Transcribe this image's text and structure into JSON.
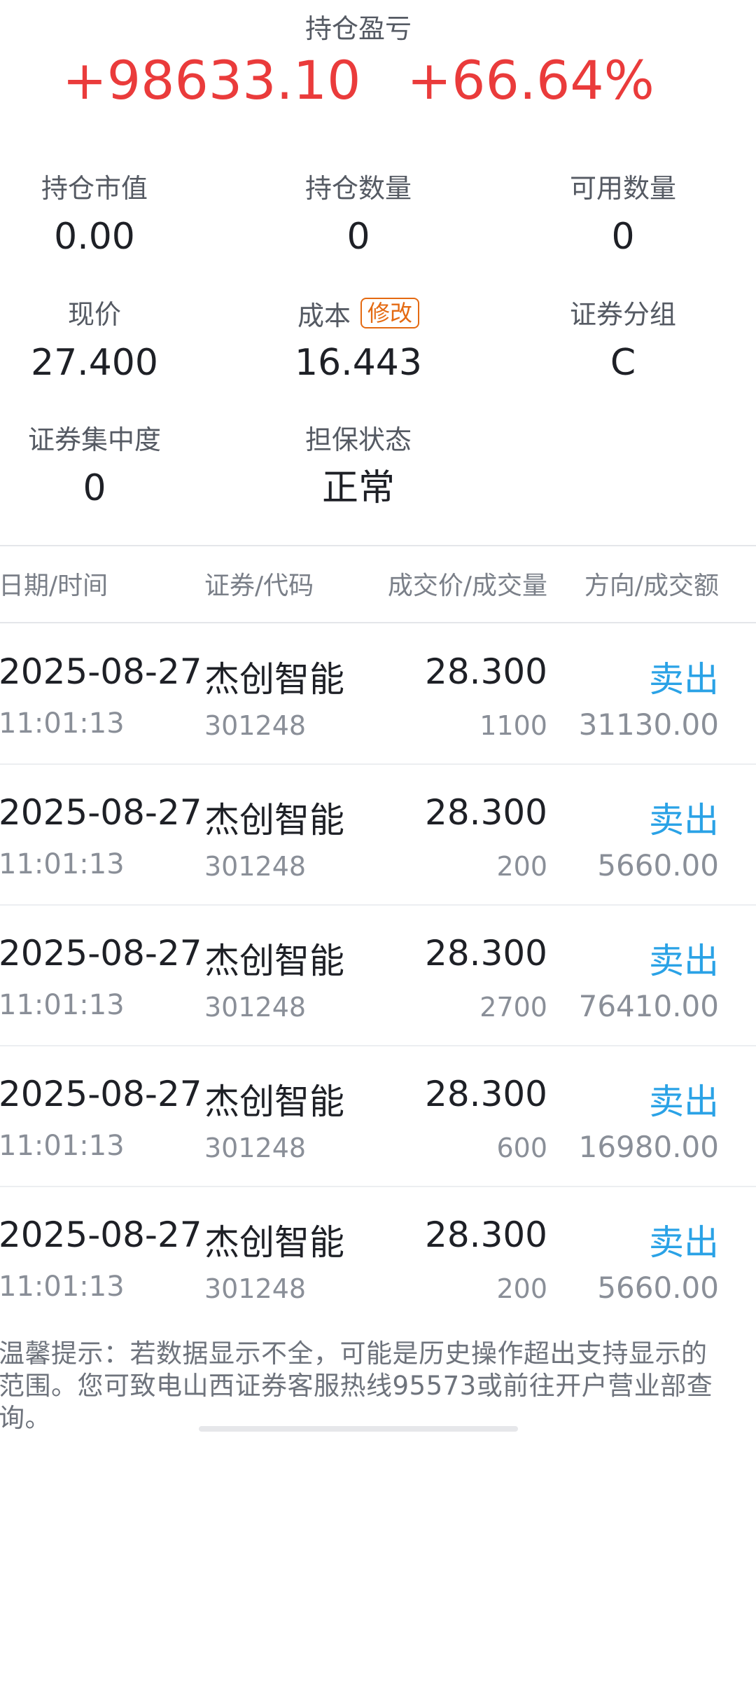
{
  "summary": {
    "title": "持仓盈亏",
    "profit": "+98633.10",
    "profit_pct": "+66.64%"
  },
  "stats": {
    "market_value": {
      "label": "持仓市值",
      "value": "0.00"
    },
    "position_qty": {
      "label": "持仓数量",
      "value": "0"
    },
    "available_qty": {
      "label": "可用数量",
      "value": "0"
    },
    "current_price": {
      "label": "现价",
      "value": "27.400"
    },
    "cost": {
      "label": "成本",
      "value": "16.443",
      "edit_label": "修改"
    },
    "security_group": {
      "label": "证券分组",
      "value": "C"
    },
    "concentration": {
      "label": "证券集中度",
      "value": "0"
    },
    "collateral_status": {
      "label": "担保状态",
      "value": "正常"
    }
  },
  "table": {
    "headers": [
      "日期/时间",
      "证券/代码",
      "成交价/成交量",
      "方向/成交额"
    ],
    "rows": [
      {
        "date": "2025-08-27",
        "time": "11:01:13",
        "name": "杰创智能",
        "code": "301248",
        "price": "28.300",
        "qty": "1100",
        "direction": "卖出",
        "amount": "31130.00"
      },
      {
        "date": "2025-08-27",
        "time": "11:01:13",
        "name": "杰创智能",
        "code": "301248",
        "price": "28.300",
        "qty": "200",
        "direction": "卖出",
        "amount": "5660.00"
      },
      {
        "date": "2025-08-27",
        "time": "11:01:13",
        "name": "杰创智能",
        "code": "301248",
        "price": "28.300",
        "qty": "2700",
        "direction": "卖出",
        "amount": "76410.00"
      },
      {
        "date": "2025-08-27",
        "time": "11:01:13",
        "name": "杰创智能",
        "code": "301248",
        "price": "28.300",
        "qty": "600",
        "direction": "卖出",
        "amount": "16980.00"
      },
      {
        "date": "2025-08-27",
        "time": "11:01:13",
        "name": "杰创智能",
        "code": "301248",
        "price": "28.300",
        "qty": "200",
        "direction": "卖出",
        "amount": "5660.00"
      }
    ]
  },
  "footer": {
    "tip": "温馨提示：若数据显示不全，可能是历史操作超出支持显示的范围。您可致电山西证券客服热线95573或前往开户营业部查询。"
  },
  "colors": {
    "profit_red": "#ea3b3b",
    "sell_blue": "#2aa2e6",
    "edit_orange": "#e46a12"
  }
}
